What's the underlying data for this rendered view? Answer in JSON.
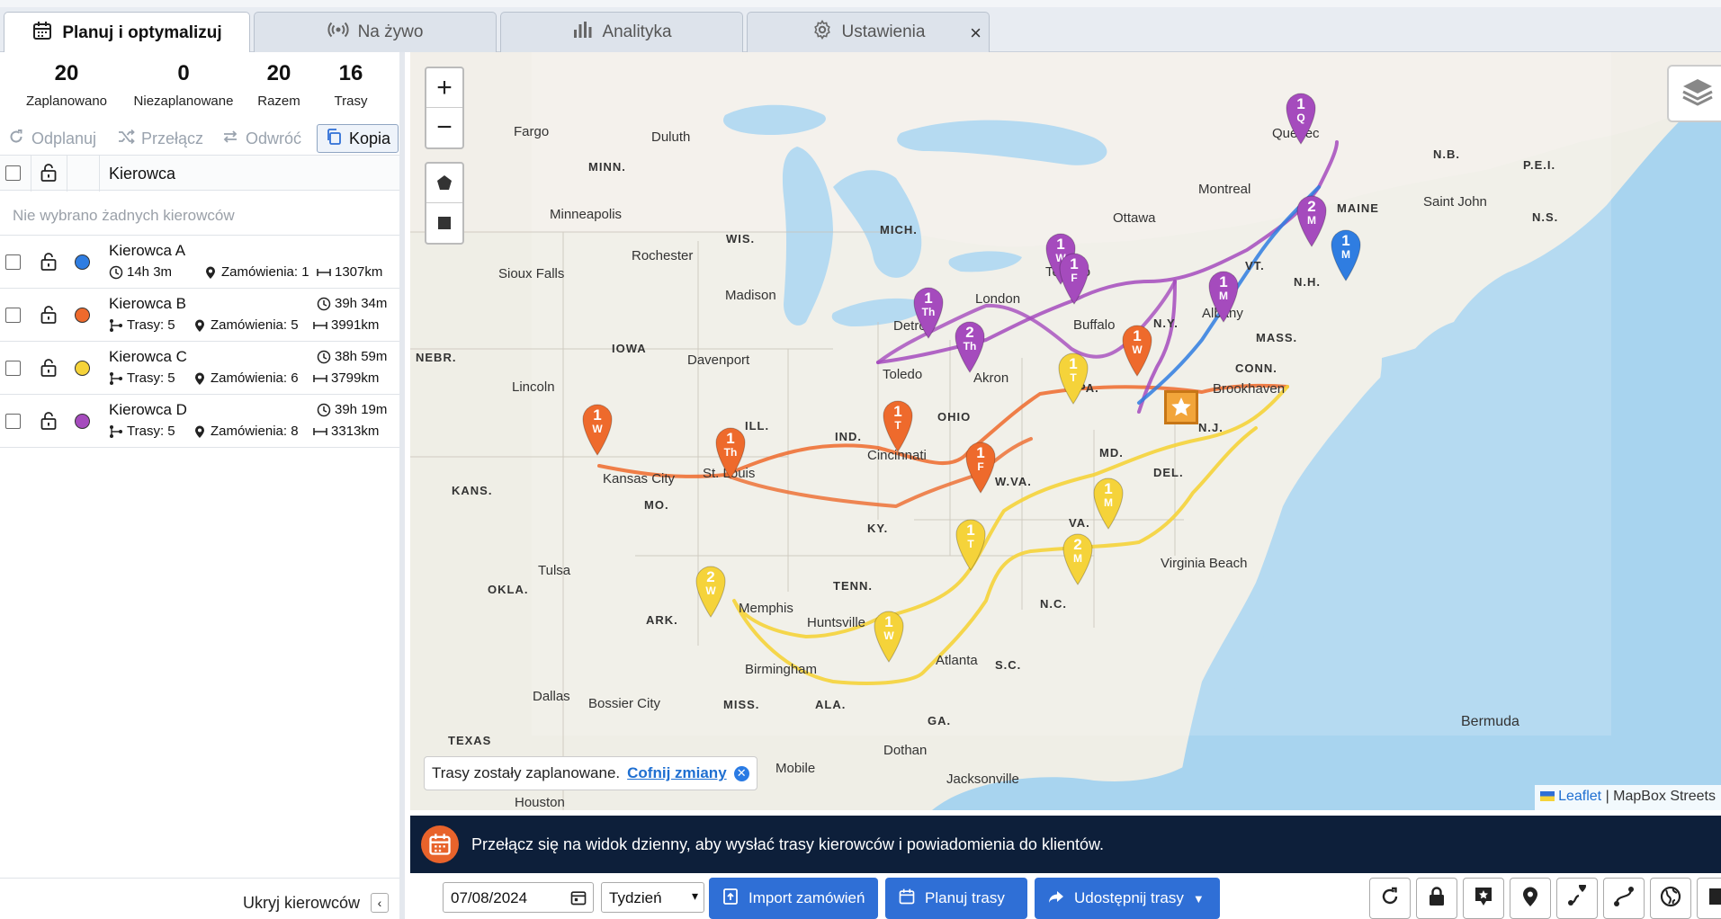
{
  "tabs": [
    {
      "label": "Planuj i optymalizuj",
      "icon": "calendar-icon"
    },
    {
      "label": "Na żywo",
      "icon": "broadcast-icon"
    },
    {
      "label": "Analityka",
      "icon": "bar-chart-icon"
    },
    {
      "label": "Ustawienia",
      "icon": "gear-icon"
    }
  ],
  "tab_close": "×",
  "stats": [
    {
      "num": "20",
      "label": "Zaplanowano"
    },
    {
      "num": "0",
      "label": "Niezaplanowane"
    },
    {
      "num": "20",
      "label": "Razem"
    },
    {
      "num": "16",
      "label": "Trasy"
    }
  ],
  "actions": {
    "unplan": "Odplanuj",
    "switch": "Przełącz",
    "reverse": "Odwróć",
    "copy": "Kopia"
  },
  "table": {
    "header": "Kierowca",
    "empty": "Nie wybrano żadnych kierowców"
  },
  "drivers": [
    {
      "name": "Kierowca A",
      "color": "#2f7de1",
      "time": "14h 3m",
      "orders": "Zamówienia: 1",
      "distance": "1307km"
    },
    {
      "name": "Kierowca B",
      "color": "#ee6a2c",
      "time": "39h 34m",
      "routes": "Trasy: 5",
      "orders": "Zamówienia: 5",
      "distance": "3991km"
    },
    {
      "name": "Kierowca C",
      "color": "#f5d33a",
      "time": "38h 59m",
      "routes": "Trasy: 5",
      "orders": "Zamówienia: 6",
      "distance": "3799km"
    },
    {
      "name": "Kierowca D",
      "color": "#a54bbd",
      "time": "39h 19m",
      "routes": "Trasy: 5",
      "orders": "Zamówienia: 8",
      "distance": "3313km"
    }
  ],
  "sidebar_footer": {
    "hide": "Ukryj kierowców"
  },
  "map": {
    "zoom_in": "+",
    "zoom_out": "−",
    "toast": {
      "text": "Trasy zostały zaplanowane.",
      "undo": "Cofnij zmiany"
    },
    "attribution": {
      "leaflet": "Leaflet",
      "rest": " | MapBox Streets"
    },
    "cities": [
      "Fargo",
      "Duluth",
      "Minneapolis",
      "Rochester",
      "Sioux Falls",
      "Madison",
      "Detroit",
      "London",
      "Toronto",
      "Ottawa",
      "Montreal",
      "Quebec",
      "Saint John",
      "Buffalo",
      "Albany",
      "Toledo",
      "Akron",
      "Davenport",
      "Lincoln",
      "Kansas City",
      "St. Louis",
      "Cincinnati",
      "Brookhaven",
      "Tulsa",
      "Memphis",
      "Huntsville",
      "Birmingham",
      "Atlanta",
      "Dallas",
      "Bossier City",
      "Dothan",
      "Mobile",
      "Jacksonville",
      "Houston",
      "Virginia Beach",
      "Bermuda"
    ],
    "states": [
      "MINN.",
      "WIS.",
      "MICH.",
      "IOWA",
      "NEBR.",
      "ILL.",
      "IND.",
      "OHIO",
      "PA.",
      "N.Y.",
      "VT.",
      "N.H.",
      "MASS.",
      "CONN.",
      "N.J.",
      "DEL.",
      "MD.",
      "W.VA.",
      "VA.",
      "KY.",
      "TENN.",
      "N.C.",
      "S.C.",
      "GA.",
      "ALA.",
      "MISS.",
      "ARK.",
      "MO.",
      "KANS.",
      "OKLA.",
      "TEXAS",
      "MAINE",
      "N.B.",
      "P.E.I.",
      "N.S."
    ],
    "pins": [
      {
        "n": "1",
        "d": "Q",
        "c": "#a54bbd"
      },
      {
        "n": "2",
        "d": "M",
        "c": "#a54bbd"
      },
      {
        "n": "1",
        "d": "M",
        "c": "#2f7de1"
      },
      {
        "n": "1",
        "d": "W",
        "c": "#a54bbd"
      },
      {
        "n": "1",
        "d": "F",
        "c": "#a54bbd"
      },
      {
        "n": "1",
        "d": "M",
        "c": "#a54bbd"
      },
      {
        "n": "1",
        "d": "Th",
        "c": "#a54bbd"
      },
      {
        "n": "2",
        "d": "Th",
        "c": "#a54bbd"
      },
      {
        "n": "1",
        "d": "W",
        "c": "#ee6a2c"
      },
      {
        "n": "1",
        "d": "T",
        "c": "#f5d33a"
      },
      {
        "n": "1",
        "d": "W",
        "c": "#ee6a2c"
      },
      {
        "n": "1",
        "d": "Th",
        "c": "#ee6a2c"
      },
      {
        "n": "1",
        "d": "T",
        "c": "#ee6a2c"
      },
      {
        "n": "1",
        "d": "F",
        "c": "#ee6a2c"
      },
      {
        "n": "1",
        "d": "M",
        "c": "#f5d33a"
      },
      {
        "n": "1",
        "d": "T",
        "c": "#f5d33a"
      },
      {
        "n": "2",
        "d": "M",
        "c": "#f5d33a"
      },
      {
        "n": "2",
        "d": "W",
        "c": "#f5d33a"
      },
      {
        "n": "1",
        "d": "W",
        "c": "#f5d33a"
      }
    ]
  },
  "infobar": {
    "text": "Przełącz się na widok dzienny, aby wysłać trasy kierowców i powiadomienia do klientów."
  },
  "toolbar": {
    "date": "07/08/2024",
    "period": "Tydzień",
    "import": "Import zamówień",
    "plan": "Planuj trasy",
    "share": "Udostępnij trasy"
  }
}
